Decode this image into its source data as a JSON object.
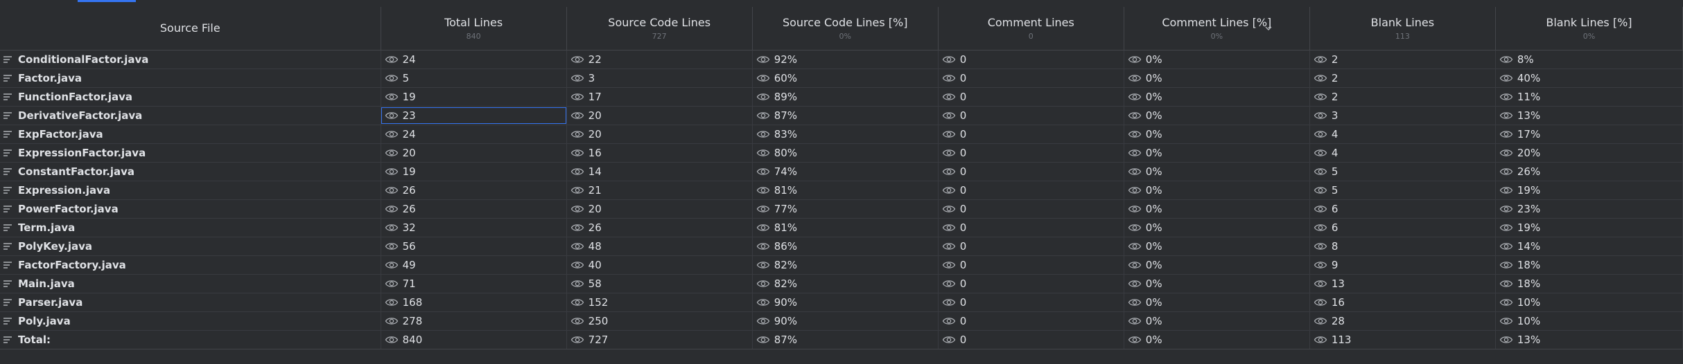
{
  "header": {
    "columns": [
      {
        "label": "Source File",
        "sub": ""
      },
      {
        "label": "Total Lines",
        "sub": "840"
      },
      {
        "label": "Source Code Lines",
        "sub": "727"
      },
      {
        "label": "Source Code Lines [%]",
        "sub": "0%"
      },
      {
        "label": "Comment Lines",
        "sub": "0"
      },
      {
        "label": "Comment Lines [%]",
        "sub": "0%"
      },
      {
        "label": "Blank Lines",
        "sub": "113"
      },
      {
        "label": "Blank Lines [%]",
        "sub": "0%"
      }
    ],
    "sorted_column": "Comment Lines [%]",
    "sort_icon": "chevron-down-icon"
  },
  "rows": [
    {
      "file": "ConditionalFactor.java",
      "total": "24",
      "src": "22",
      "src_pct": "92%",
      "comment": "0",
      "comment_pct": "0%",
      "blank": "2",
      "blank_pct": "8%"
    },
    {
      "file": "Factor.java",
      "total": "5",
      "src": "3",
      "src_pct": "60%",
      "comment": "0",
      "comment_pct": "0%",
      "blank": "2",
      "blank_pct": "40%"
    },
    {
      "file": "FunctionFactor.java",
      "total": "19",
      "src": "17",
      "src_pct": "89%",
      "comment": "0",
      "comment_pct": "0%",
      "blank": "2",
      "blank_pct": "11%"
    },
    {
      "file": "DerivativeFactor.java",
      "total": "23",
      "src": "20",
      "src_pct": "87%",
      "comment": "0",
      "comment_pct": "0%",
      "blank": "3",
      "blank_pct": "13%"
    },
    {
      "file": "ExpFactor.java",
      "total": "24",
      "src": "20",
      "src_pct": "83%",
      "comment": "0",
      "comment_pct": "0%",
      "blank": "4",
      "blank_pct": "17%"
    },
    {
      "file": "ExpressionFactor.java",
      "total": "20",
      "src": "16",
      "src_pct": "80%",
      "comment": "0",
      "comment_pct": "0%",
      "blank": "4",
      "blank_pct": "20%"
    },
    {
      "file": "ConstantFactor.java",
      "total": "19",
      "src": "14",
      "src_pct": "74%",
      "comment": "0",
      "comment_pct": "0%",
      "blank": "5",
      "blank_pct": "26%"
    },
    {
      "file": "Expression.java",
      "total": "26",
      "src": "21",
      "src_pct": "81%",
      "comment": "0",
      "comment_pct": "0%",
      "blank": "5",
      "blank_pct": "19%"
    },
    {
      "file": "PowerFactor.java",
      "total": "26",
      "src": "20",
      "src_pct": "77%",
      "comment": "0",
      "comment_pct": "0%",
      "blank": "6",
      "blank_pct": "23%"
    },
    {
      "file": "Term.java",
      "total": "32",
      "src": "26",
      "src_pct": "81%",
      "comment": "0",
      "comment_pct": "0%",
      "blank": "6",
      "blank_pct": "19%"
    },
    {
      "file": "PolyKey.java",
      "total": "56",
      "src": "48",
      "src_pct": "86%",
      "comment": "0",
      "comment_pct": "0%",
      "blank": "8",
      "blank_pct": "14%"
    },
    {
      "file": "FactorFactory.java",
      "total": "49",
      "src": "40",
      "src_pct": "82%",
      "comment": "0",
      "comment_pct": "0%",
      "blank": "9",
      "blank_pct": "18%"
    },
    {
      "file": "Main.java",
      "total": "71",
      "src": "58",
      "src_pct": "82%",
      "comment": "0",
      "comment_pct": "0%",
      "blank": "13",
      "blank_pct": "18%"
    },
    {
      "file": "Parser.java",
      "total": "168",
      "src": "152",
      "src_pct": "90%",
      "comment": "0",
      "comment_pct": "0%",
      "blank": "16",
      "blank_pct": "10%"
    },
    {
      "file": "Poly.java",
      "total": "278",
      "src": "250",
      "src_pct": "90%",
      "comment": "0",
      "comment_pct": "0%",
      "blank": "28",
      "blank_pct": "10%"
    },
    {
      "file": "Total:",
      "total": "840",
      "src": "727",
      "src_pct": "87%",
      "comment": "0",
      "comment_pct": "0%",
      "blank": "113",
      "blank_pct": "13%"
    }
  ],
  "selection": {
    "row_file": "DerivativeFactor.java",
    "column": "Total Lines"
  },
  "icons": {
    "file_row": "lines-icon",
    "value": "eye-icon"
  },
  "colors": {
    "background": "#2b2d30",
    "text": "#dfe1e5",
    "muted": "#6f737a",
    "accent": "#3574f0",
    "grid": "#393b40"
  }
}
